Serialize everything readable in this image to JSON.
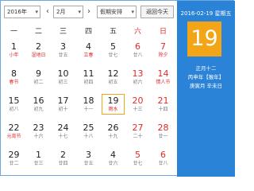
{
  "toolbar": {
    "year_value": "2016年",
    "prev_label": "‹",
    "month_value": "2月",
    "next_label": "›",
    "holiday_value": "假期安排",
    "today_label": "返回今天"
  },
  "weekdays": [
    "一",
    "二",
    "三",
    "四",
    "五",
    "六",
    "日"
  ],
  "rows": [
    [
      {
        "n": "1",
        "l": "小年",
        "fest": true
      },
      {
        "n": "2",
        "l": "湿地日",
        "fest": true
      },
      {
        "n": "3",
        "l": "廿五"
      },
      {
        "n": "4",
        "l": "立春",
        "fest": true
      },
      {
        "n": "5",
        "l": "廿七"
      },
      {
        "n": "6",
        "l": "廿八"
      },
      {
        "n": "7",
        "l": "除夕",
        "fest": true
      }
    ],
    [
      {
        "n": "8",
        "l": "春节",
        "fest": true
      },
      {
        "n": "9",
        "l": "初二"
      },
      {
        "n": "10",
        "l": "初三"
      },
      {
        "n": "11",
        "l": "初四"
      },
      {
        "n": "12",
        "l": "初五"
      },
      {
        "n": "13",
        "l": "初六"
      },
      {
        "n": "14",
        "l": "情人节",
        "fest": true
      }
    ],
    [
      {
        "n": "15",
        "l": "初八"
      },
      {
        "n": "16",
        "l": "初九"
      },
      {
        "n": "17",
        "l": "初十"
      },
      {
        "n": "18",
        "l": "十一"
      },
      {
        "n": "19",
        "l": "雨水",
        "selected": true
      },
      {
        "n": "20",
        "l": "十三"
      },
      {
        "n": "21",
        "l": "十四"
      }
    ],
    [
      {
        "n": "22",
        "l": "元宵节",
        "fest": true
      },
      {
        "n": "23",
        "l": "十六"
      },
      {
        "n": "24",
        "l": "十七"
      },
      {
        "n": "25",
        "l": "十八"
      },
      {
        "n": "26",
        "l": "十九"
      },
      {
        "n": "27",
        "l": "二十"
      },
      {
        "n": "28",
        "l": "廿一"
      }
    ],
    [
      {
        "n": "29",
        "l": "廿二"
      },
      {
        "n": "1",
        "l": "廿三"
      },
      {
        "n": "2",
        "l": "廿四"
      },
      {
        "n": "3",
        "l": "廿五"
      },
      {
        "n": "4",
        "l": "廿六"
      },
      {
        "n": "5",
        "l": "廿七"
      },
      {
        "n": "6",
        "l": "廿八"
      }
    ]
  ],
  "panel": {
    "date_line": "2016-02-19 星期五",
    "big_day": "19",
    "lunar_line": "正月十二",
    "ganzhi_line": "丙申年【猴年】",
    "ganzhi_line2": "庚寅月 辛未日"
  },
  "colors": {
    "accent_blue": "#2b83d7",
    "selected_orange": "#f2a516",
    "weekend_red": "#e02a2a"
  }
}
